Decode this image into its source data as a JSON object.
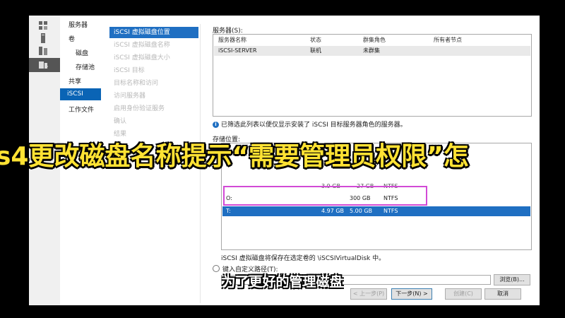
{
  "nav_tree": {
    "servers": "服务器",
    "volumes": "卷",
    "disks": "磁盘",
    "storage_pools": "存储池",
    "shares": "共享",
    "iscsi": "iSCSI",
    "work_folders": "工作文件"
  },
  "wizard": {
    "steps": [
      {
        "label": "iSCSI 虚拟磁盘位置"
      },
      {
        "label": "iSCSI 虚拟磁盘名称"
      },
      {
        "label": "iSCSI 虚拟磁盘大小"
      },
      {
        "label": "iSCSI 目标"
      },
      {
        "label": "目标名称和访问"
      },
      {
        "label": "访问服务器"
      },
      {
        "label": "启用身份验证服务"
      },
      {
        "label": "确认"
      },
      {
        "label": "结果"
      }
    ]
  },
  "server_section": {
    "label": "服务器(S):",
    "columns": [
      "服务器名称",
      "状态",
      "群集角色",
      "所有者节点"
    ],
    "rows": [
      {
        "name": "iSCSI-SERVER",
        "status": "联机",
        "role": "未群集",
        "owner": ""
      }
    ],
    "info": "已筛选此列表以便仅显示安装了 iSCSI 目标服务器角色的服务器。"
  },
  "storage_section": {
    "label": "存储位置:",
    "rows": [
      {
        "volume": "",
        "free": "",
        "capacity": "",
        "fs": ""
      },
      {
        "volume": "O:",
        "free": "",
        "capacity": "300 GB",
        "fs": "NTFS"
      },
      {
        "volume": "T:",
        "free": "4.97 GB",
        "capacity": "5.00 GB",
        "fs": "NTFS"
      }
    ],
    "partial_row": {
      "free": "3.9 GB",
      "capacity": "27 GB",
      "fs": "NTFS"
    },
    "path_note": "iSCSI 虚拟磁盘将保存在选定卷的 \\iSCSIVirtualDisk 中。",
    "custom_path_label": "键入自定义路径(T):",
    "browse": "浏览(B)..."
  },
  "buttons": {
    "prev": "< 上一步(P)",
    "next": "下一步(N) >",
    "create": "创建(C)",
    "cancel": "取消"
  },
  "captions": {
    "main": "s4更改磁盘名称提示“需要管理员权限”怎",
    "sub": "为了更好的管理磁盘"
  },
  "colors": {
    "caption_main": "#ffe233",
    "selection": "#1f6fc2",
    "highlight_box": "#d24ad6"
  }
}
